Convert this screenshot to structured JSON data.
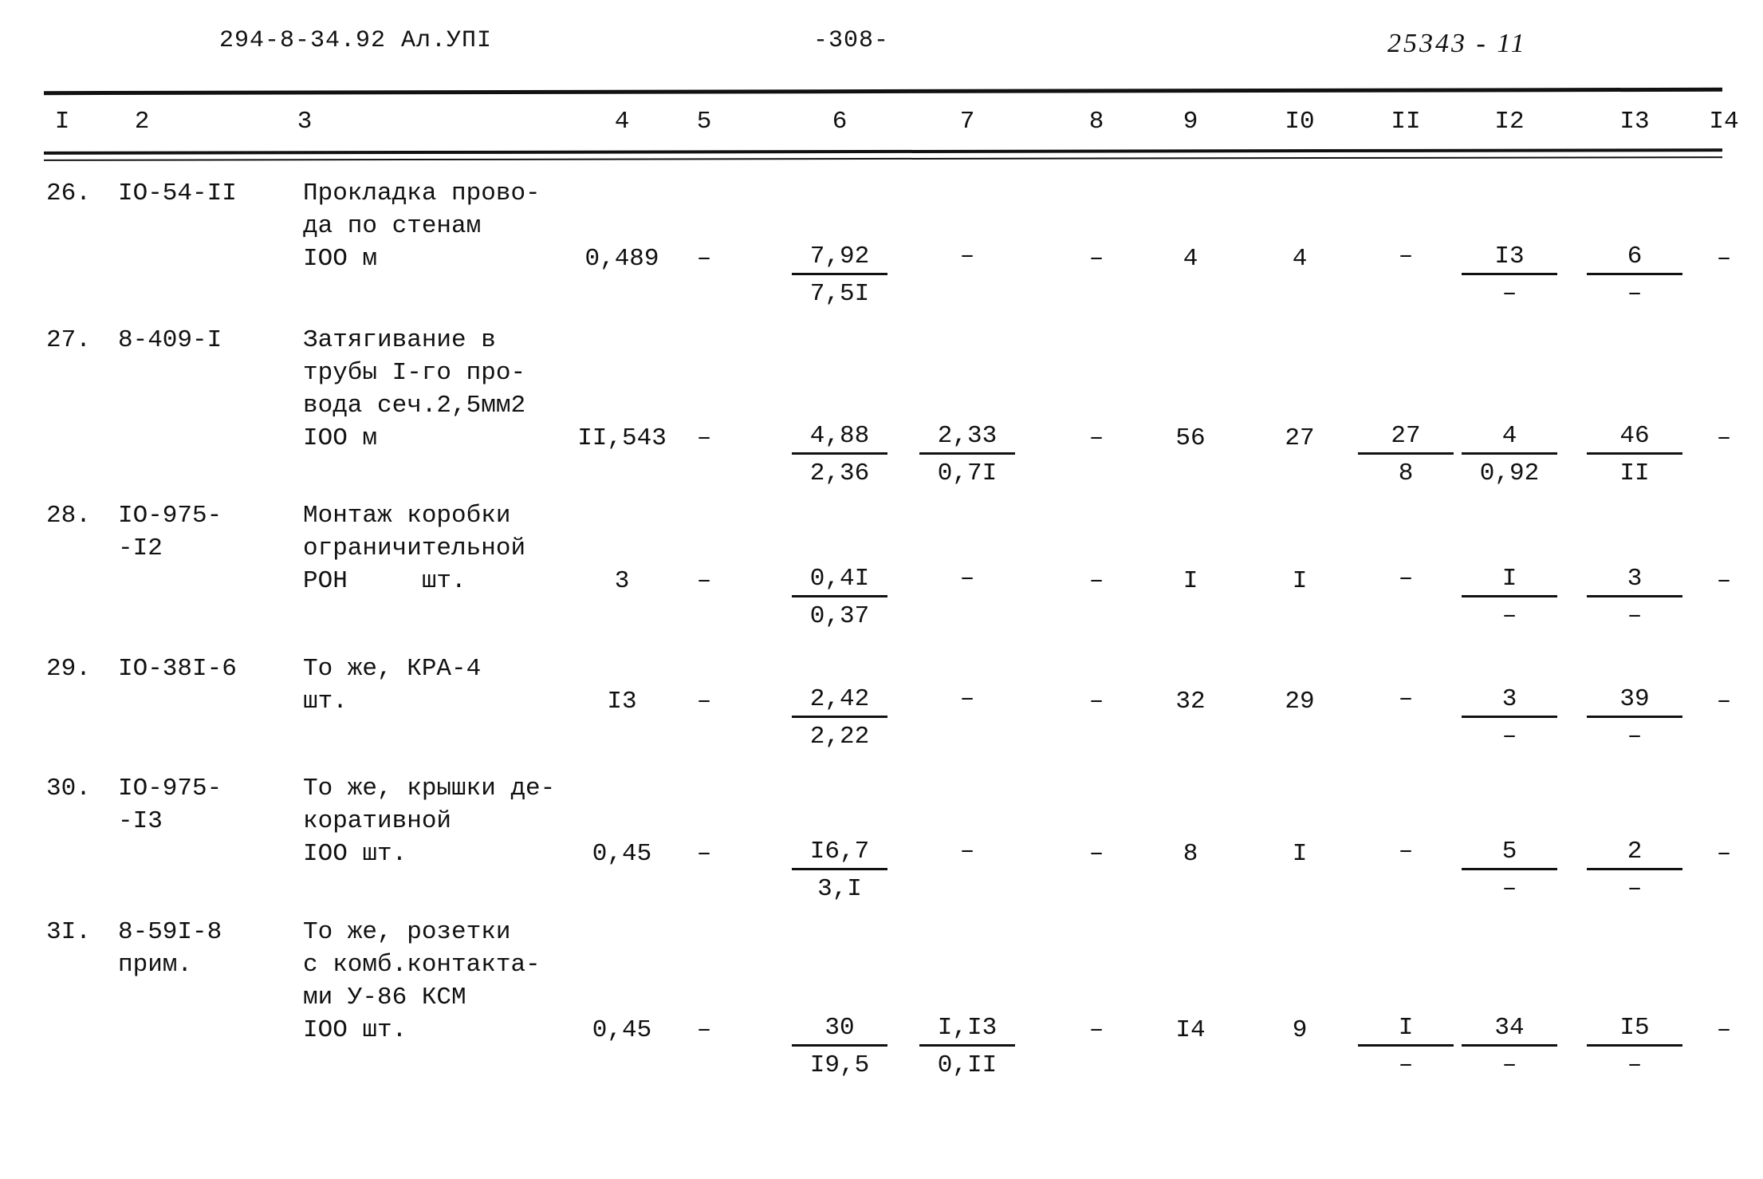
{
  "header": {
    "left": "294-8-34.92 Ал.УПI",
    "center": "-308-",
    "right": "25343 - 11"
  },
  "table": {
    "column_headers": [
      "I",
      "2",
      "3",
      "4",
      "5",
      "6",
      "7",
      "8",
      "9",
      "I0",
      "II",
      "I2",
      "I3",
      "I4"
    ],
    "rows": [
      {
        "num": "26.",
        "code": "IO-54-II",
        "desc_lines": [
          "Прокладка прово-",
          "да по стенам",
          "IOO м"
        ],
        "c4": "0,489",
        "c5": "–",
        "c6_top": "7,92",
        "c6_bot": "7,5I",
        "c7_top": "–",
        "c7_bot": "",
        "c8": "–",
        "c9": "4",
        "c10": "4",
        "c11_top": "–",
        "c11_bot": "",
        "c12_top": "I3",
        "c12_bot": "–",
        "c13_top": "6",
        "c13_bot": "–",
        "c14": "–"
      },
      {
        "num": "27.",
        "code": "8-409-I",
        "desc_lines": [
          "Затягивание в",
          "трубы I-го про-",
          "вода сеч.2,5мм2",
          "IOO м"
        ],
        "c4": "II,543",
        "c5": "–",
        "c6_top": "4,88",
        "c6_bot": "2,36",
        "c7_top": "2,33",
        "c7_bot": "0,7I",
        "c8": "–",
        "c9": "56",
        "c10": "27",
        "c11_top": "27",
        "c11_bot": "8",
        "c12_top": "4",
        "c12_bot": "0,92",
        "c13_top": "46",
        "c13_bot": "II",
        "c14": "–"
      },
      {
        "num": "28.",
        "code": "IO-975-",
        "code2": "-I2",
        "desc_lines": [
          "Монтаж коробки",
          "ограничительной",
          "РОН     шт."
        ],
        "c4": "3",
        "c5": "–",
        "c6_top": "0,4I",
        "c6_bot": "0,37",
        "c7_top": "–",
        "c7_bot": "",
        "c8": "–",
        "c9": "I",
        "c10": "I",
        "c11_top": "–",
        "c11_bot": "",
        "c12_top": "I",
        "c12_bot": "–",
        "c13_top": "3",
        "c13_bot": "–",
        "c14": "–"
      },
      {
        "num": "29.",
        "code": "IO-38I-6",
        "desc_lines": [
          "То же, КРА-4",
          "шт."
        ],
        "c4": "I3",
        "c5": "–",
        "c6_top": "2,42",
        "c6_bot": "2,22",
        "c7_top": "–",
        "c7_bot": "",
        "c8": "–",
        "c9": "32",
        "c10": "29",
        "c11_top": "–",
        "c11_bot": "",
        "c12_top": "3",
        "c12_bot": "–",
        "c13_top": "39",
        "c13_bot": "–",
        "c14": "–"
      },
      {
        "num": "30.",
        "code": "IO-975-",
        "code2": "-I3",
        "desc_lines": [
          "То же, крышки де-",
          "коративной",
          "IOO шт."
        ],
        "c4": "0,45",
        "c5": "–",
        "c6_top": "I6,7",
        "c6_bot": "3,I",
        "c7_top": "–",
        "c7_bot": "",
        "c8": "–",
        "c9": "8",
        "c10": "I",
        "c11_top": "–",
        "c11_bot": "",
        "c12_top": "5",
        "c12_bot": "–",
        "c13_top": "2",
        "c13_bot": "–",
        "c14": "–"
      },
      {
        "num": "3I.",
        "code": "8-59I-8",
        "code2": "прим.",
        "desc_lines": [
          "То же, розетки",
          "с комб.контакта-",
          "ми У-86 КСМ",
          "IOO шт."
        ],
        "c4": "0,45",
        "c5": "–",
        "c6_top": "30",
        "c6_bot": "I9,5",
        "c7_top": "I,I3",
        "c7_bot": "0,II",
        "c8": "–",
        "c9": "I4",
        "c10": "9",
        "c11_top": "I",
        "c11_bot": "–",
        "c12_top": "34",
        "c12_bot": "–",
        "c13_top": "I5",
        "c13_bot": "–",
        "c14": "–"
      }
    ]
  }
}
